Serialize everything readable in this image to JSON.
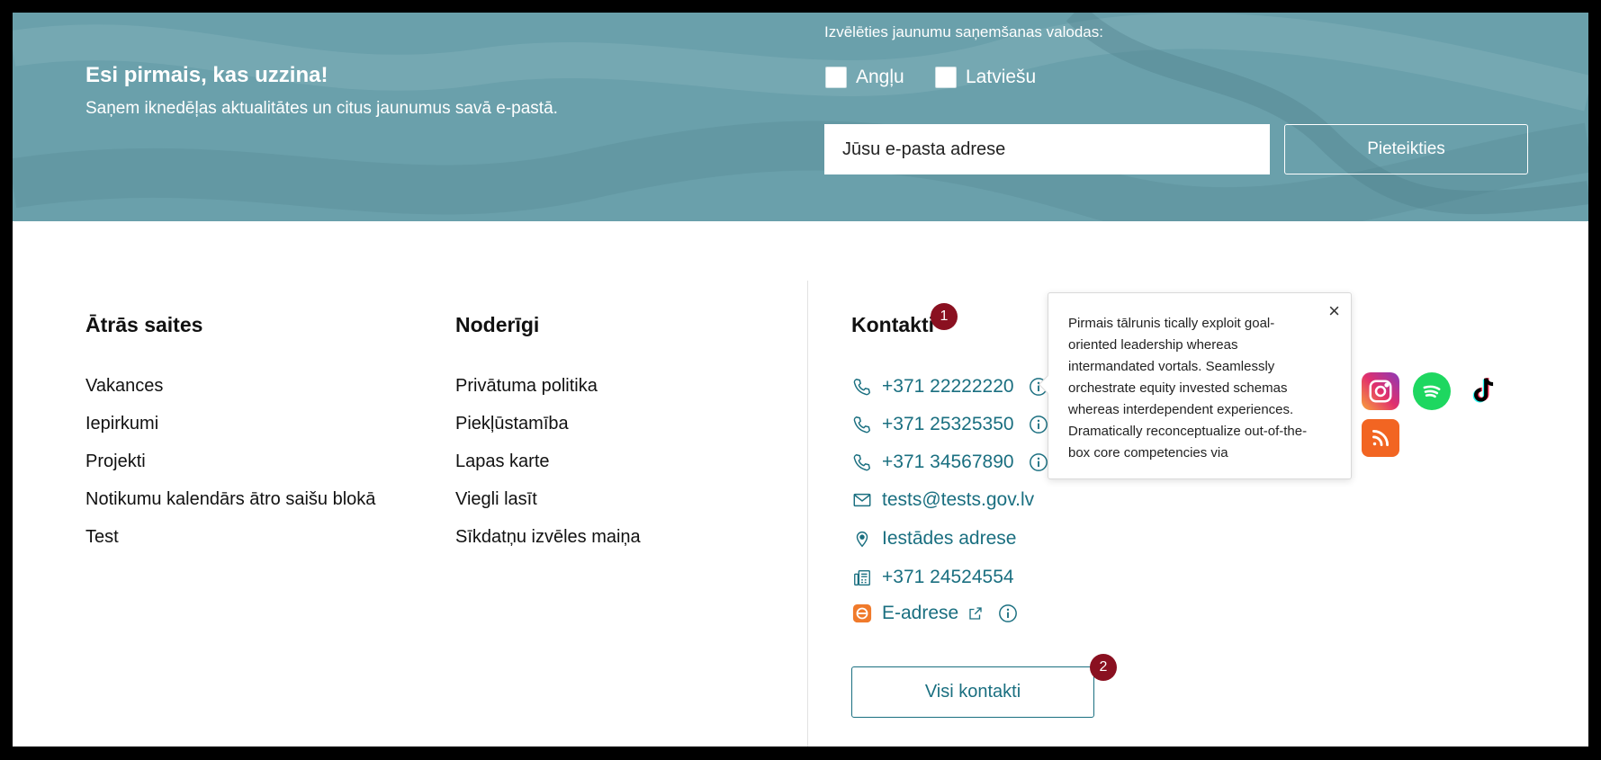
{
  "newsletter": {
    "title": "Esi pirmais, kas uzzina!",
    "subtitle": "Saņem iknedēļas aktualitātes un citus jaunumus savā e-pastā.",
    "language_label": "Izvēlēties jaunumu saņemšanas valodas:",
    "languages": [
      {
        "label": "Angļu",
        "checked": false
      },
      {
        "label": "Latviešu",
        "checked": false
      }
    ],
    "email_placeholder": "Jūsu e-pasta adrese",
    "subscribe_label": "Pieteikties",
    "background_color": "#6aa0ab"
  },
  "quick_links": {
    "title": "Ātrās saites",
    "items": [
      "Vakances",
      "Iepirkumi",
      "Projekti",
      "Notikumu kalendārs ātro saišu blokā",
      "Test"
    ]
  },
  "useful": {
    "title": "Noderīgi",
    "items": [
      "Privātuma politika",
      "Piekļūstamība",
      "Lapas karte",
      "Viegli lasīt",
      "Sīkdatņu izvēles maiņa"
    ]
  },
  "contacts": {
    "title": "Kontakti",
    "phones": [
      "+371 22222220",
      "+371 25325350",
      "+371 34567890"
    ],
    "email": "tests@tests.gov.lv",
    "address": "Iestādes adrese",
    "fax": "+371 24524554",
    "e_address": "E-adrese",
    "all_contacts_label": "Visi kontakti",
    "accent_color": "#1a6f80"
  },
  "tooltip": {
    "text": "Pirmais tālrunis tically exploit goal-oriented leadership whereas intermandated vortals. Seamlessly orchestrate equity invested schemas whereas interdependent experiences. Dramatically reconceptualize out-of-the-box core competencies via",
    "close_glyph": "×"
  },
  "badges": [
    "1",
    "2"
  ],
  "social_icons": [
    "instagram-icon",
    "spotify-icon",
    "tiktok-icon",
    "rss-icon"
  ]
}
